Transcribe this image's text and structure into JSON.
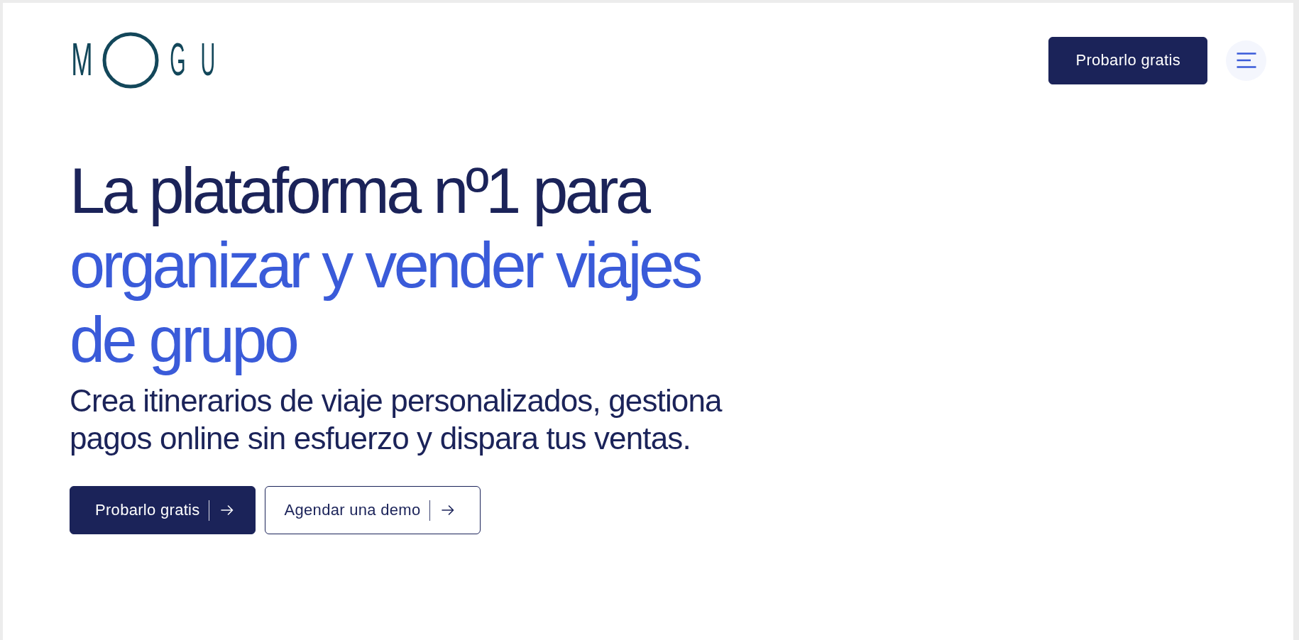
{
  "header": {
    "logo": {
      "before_ring": "M",
      "after_ring": "GU"
    },
    "cta": {
      "label": "Probarlo gratis",
      "kind": "primary",
      "arrow": false
    }
  },
  "hero": {
    "heading": [
      {
        "text": "La plataforma nº1 para",
        "highlight": false
      },
      {
        "text": "organizar y vender viajes de grupo",
        "highlight": true
      }
    ],
    "subtitle": "Crea itinerarios de viaje personalizados, gestiona pagos online sin esfuerzo y dispara tus ventas.",
    "buttons": [
      {
        "label": "Probarlo gratis",
        "kind": "primary",
        "arrow": true
      },
      {
        "label": "Agendar una demo",
        "kind": "outline",
        "arrow": true
      }
    ]
  }
}
